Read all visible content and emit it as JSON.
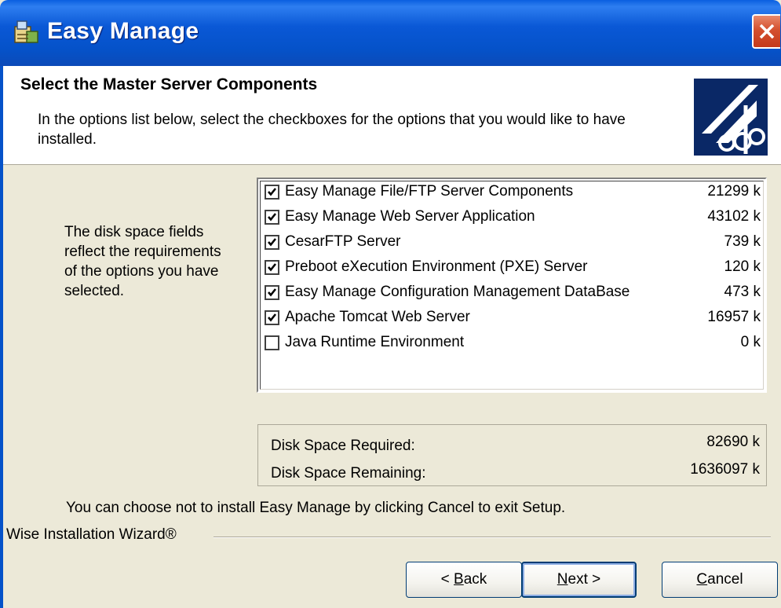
{
  "window": {
    "title": "Easy Manage"
  },
  "banner": {
    "title": "Select the Master Server Components",
    "description": "In the options list below, select the checkboxes for the options that you would like to have installed."
  },
  "side_note": "The disk space fields reflect the requirements of the options you have selected.",
  "components": [
    {
      "label": "Easy Manage File/FTP Server Components",
      "size": "21299 k",
      "checked": true
    },
    {
      "label": "Easy Manage Web Server Application",
      "size": "43102 k",
      "checked": true
    },
    {
      "label": "CesarFTP Server",
      "size": "739 k",
      "checked": true
    },
    {
      "label": "Preboot eXecution Environment (PXE) Server",
      "size": "120 k",
      "checked": true
    },
    {
      "label": "Easy Manage Configuration Management DataBase",
      "size": "473 k",
      "checked": true
    },
    {
      "label": "Apache Tomcat Web Server",
      "size": "16957 k",
      "checked": true
    },
    {
      "label": "Java Runtime Environment",
      "size": "0 k",
      "checked": false
    }
  ],
  "disk": {
    "required_label": "Disk Space Required:",
    "required_value": "82690 k",
    "remaining_label": "Disk Space Remaining:",
    "remaining_value": "1636097 k"
  },
  "cancel_note": "You can choose not to install Easy Manage by clicking Cancel to exit Setup.",
  "brand": "Wise Installation Wizard®",
  "buttons": {
    "back": {
      "prefix": "< ",
      "accel": "B",
      "rest": "ack"
    },
    "next": {
      "accel": "N",
      "rest": "ext >"
    },
    "cancel": {
      "accel": "C",
      "rest": "ancel"
    }
  }
}
